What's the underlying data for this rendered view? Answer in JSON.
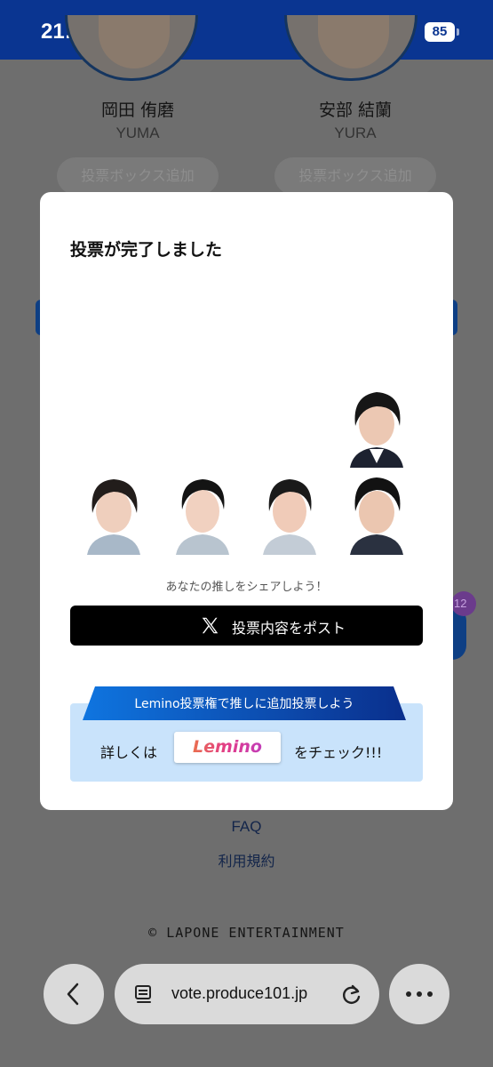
{
  "status_bar": {
    "time": "21:36",
    "battery": "85",
    "icons": [
      "moon-icon",
      "signal-icon",
      "wifi-icon",
      "battery-icon"
    ]
  },
  "background": {
    "members": [
      {
        "name": "岡田 侑磨",
        "roman": "YUMA",
        "button": "投票ボックス追加"
      },
      {
        "name": "安部 結蘭",
        "roman": "YURA",
        "button": "投票ボックス追加"
      }
    ],
    "badge_count": "12",
    "links": {
      "faq": "FAQ",
      "terms": "利用規約"
    },
    "copyright": "© LAPONE ENTERTAINMENT"
  },
  "modal": {
    "title": "投票が完了しました",
    "share_caption": "あなたの推しをシェアしよう！",
    "post_button_label": "投票内容をポスト",
    "lemino_banner": "Lemino投票権で推しに追加投票しよう",
    "details_prefix": "詳しくは",
    "lemino_logo": "Lemino",
    "details_suffix": "をチェック!!!"
  },
  "browser": {
    "url": "vote.produce101.jp",
    "icons": [
      "back-arrow-icon",
      "tabs-icon",
      "reload-icon",
      "more-dots-icon"
    ]
  },
  "colors": {
    "status_bar": "#0a3591",
    "overlay_bg": "#6e6e6e",
    "post_button": "#000000",
    "lemino_box": "#c9e3fb",
    "lemino_banner": "#0a59c9"
  }
}
